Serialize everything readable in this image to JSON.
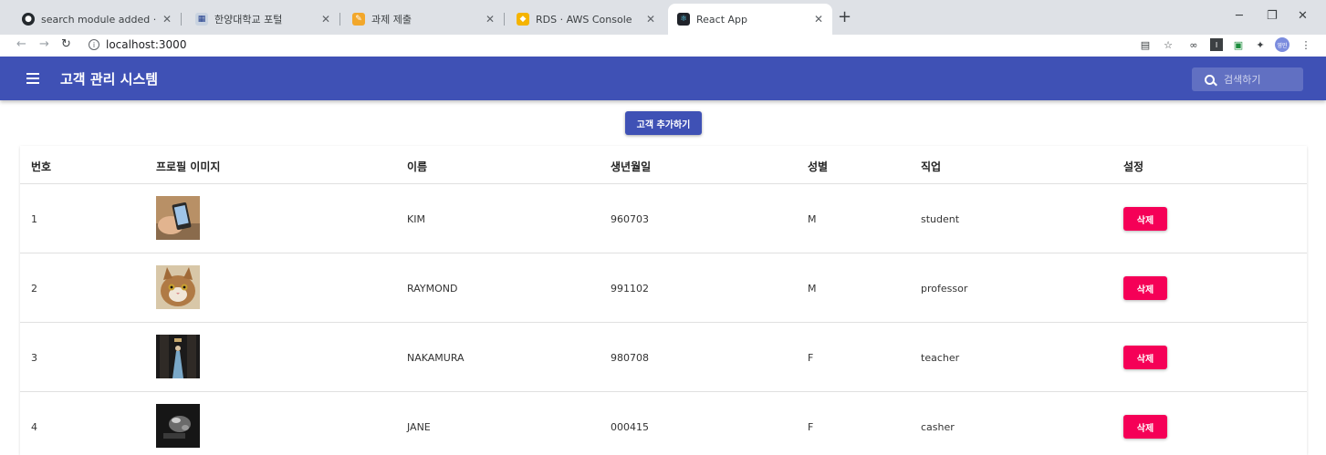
{
  "browser": {
    "tabs": [
      {
        "title": "search module added · Jaejuna",
        "icon": "github-icon"
      },
      {
        "title": "한양대학교 포털",
        "icon": "hanyang-icon"
      },
      {
        "title": "과제 제출",
        "icon": "assignment-icon"
      },
      {
        "title": "RDS · AWS Console",
        "icon": "aws-icon"
      },
      {
        "title": "React App",
        "icon": "react-icon"
      }
    ],
    "url": "localhost:3000",
    "profile_initials": "영민"
  },
  "app": {
    "title": "고객 관리 시스템",
    "search_placeholder": "검색하기",
    "add_button_label": "고객 추가하기",
    "accent_color": "#3f51b5",
    "delete_color": "#f50057"
  },
  "table": {
    "headers": [
      "번호",
      "프로필 이미지",
      "이름",
      "생년월일",
      "성별",
      "직업",
      "설정"
    ],
    "rows": [
      {
        "id": "1",
        "name": "KIM",
        "birthday": "960703",
        "gender": "M",
        "job": "student",
        "action": "삭제"
      },
      {
        "id": "2",
        "name": "RAYMOND",
        "birthday": "991102",
        "gender": "M",
        "job": "professor",
        "action": "삭제"
      },
      {
        "id": "3",
        "name": "NAKAMURA",
        "birthday": "980708",
        "gender": "F",
        "job": "teacher",
        "action": "삭제"
      },
      {
        "id": "4",
        "name": "JANE",
        "birthday": "000415",
        "gender": "F",
        "job": "casher",
        "action": "삭제"
      }
    ]
  }
}
